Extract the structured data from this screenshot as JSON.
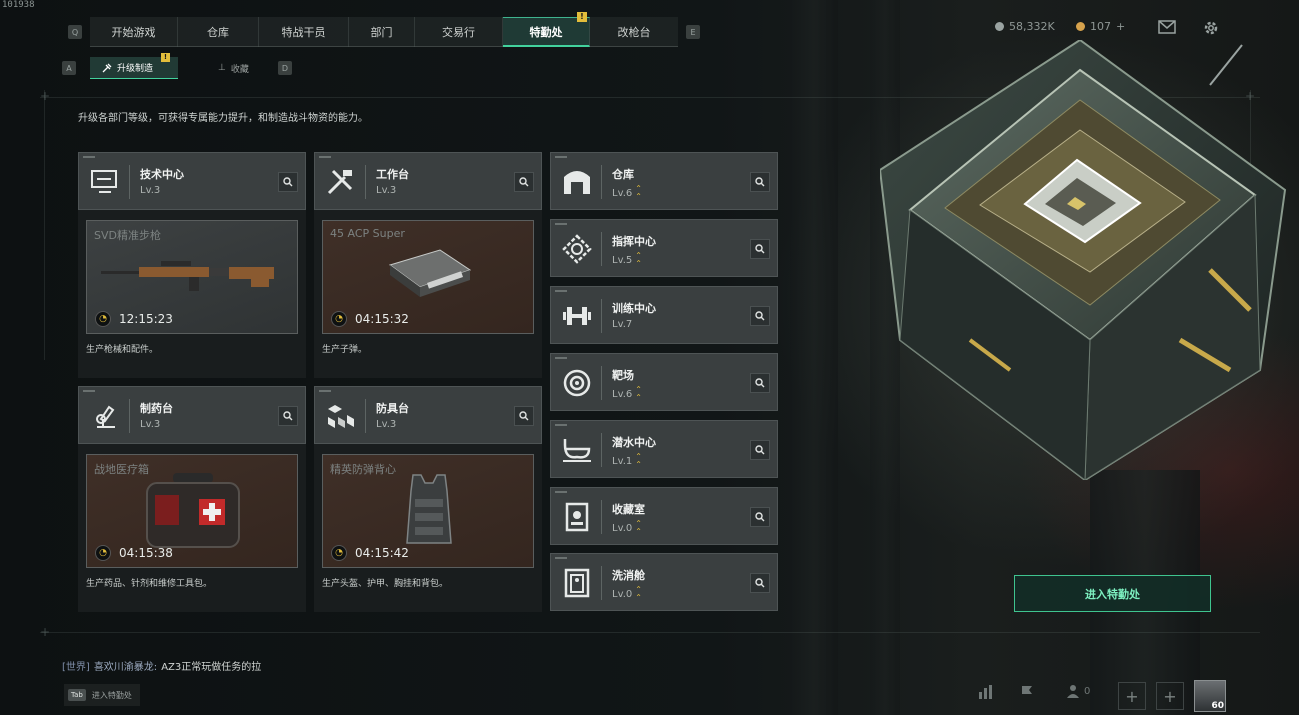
{
  "build_id": "101938",
  "nav": {
    "left_key": "Q",
    "right_key": "E",
    "tabs": [
      {
        "label": "开始游戏",
        "alert": ""
      },
      {
        "label": "仓库",
        "alert": ""
      },
      {
        "label": "特战干员",
        "alert": ""
      },
      {
        "label": "部门",
        "alert": ""
      },
      {
        "label": "交易行",
        "alert": ""
      },
      {
        "label": "特勤处",
        "alert": "!",
        "active": true
      },
      {
        "label": "改枪台",
        "alert": ""
      }
    ]
  },
  "subnav": {
    "left_key": "A",
    "right_key": "D",
    "tabs": [
      {
        "label": "升级制造",
        "alert": "!",
        "active": true
      },
      {
        "label": "收藏",
        "alert": ""
      }
    ]
  },
  "currency": {
    "money": "58,332K",
    "premium": "107",
    "premium_add": "+"
  },
  "description": "升级各部门等级，可获得专属能力提升，和制造战斗物资的能力。",
  "workshops": [
    {
      "name": "技术中心",
      "level": "Lv.3",
      "item": "SVD精准步枪",
      "timer": "12:15:23",
      "footer": "生产枪械和配件。",
      "icon": "monitor-icon",
      "bg": "gray"
    },
    {
      "name": "工作台",
      "level": "Lv.3",
      "item": "45 ACP Super",
      "timer": "04:15:32",
      "footer": "生产子弹。",
      "icon": "tools-icon",
      "bg": "brown"
    },
    {
      "name": "制药台",
      "level": "Lv.3",
      "item": "战地医疗箱",
      "timer": "04:15:38",
      "footer": "生产药品、针剂和维修工具包。",
      "icon": "microscope-icon",
      "bg": "brown"
    },
    {
      "name": "防具台",
      "level": "Lv.3",
      "item": "精英防弹背心",
      "timer": "04:15:42",
      "footer": "生产头盔、护甲、胸挂和背包。",
      "icon": "armor-boxes-icon",
      "bg": "brown"
    }
  ],
  "departments": [
    {
      "name": "仓库",
      "level": "Lv.6",
      "icon": "warehouse-icon"
    },
    {
      "name": "指挥中心",
      "level": "Lv.5",
      "icon": "command-icon"
    },
    {
      "name": "训练中心",
      "level": "Lv.7",
      "icon": "dumbbell-icon"
    },
    {
      "name": "靶场",
      "level": "Lv.6",
      "icon": "target-icon"
    },
    {
      "name": "潜水中心",
      "level": "Lv.1",
      "icon": "dive-mask-icon"
    },
    {
      "name": "收藏室",
      "level": "Lv.0",
      "icon": "collection-icon"
    },
    {
      "name": "洗消舱",
      "level": "Lv.0",
      "icon": "decon-icon"
    }
  ],
  "enter_button": "进入特勤处",
  "chat": {
    "channel": "[世界]",
    "user": "喜欢川渝暴龙:",
    "message": "AZ3正常玩做任务的拉"
  },
  "tab_hint": {
    "key": "Tab",
    "label": "进入特勤处"
  },
  "friends_count": "0",
  "player_level": "60",
  "colors": {
    "accent_green": "#42d29d",
    "alert_yellow": "#e2bd3b",
    "panel": "#3a3f40"
  }
}
